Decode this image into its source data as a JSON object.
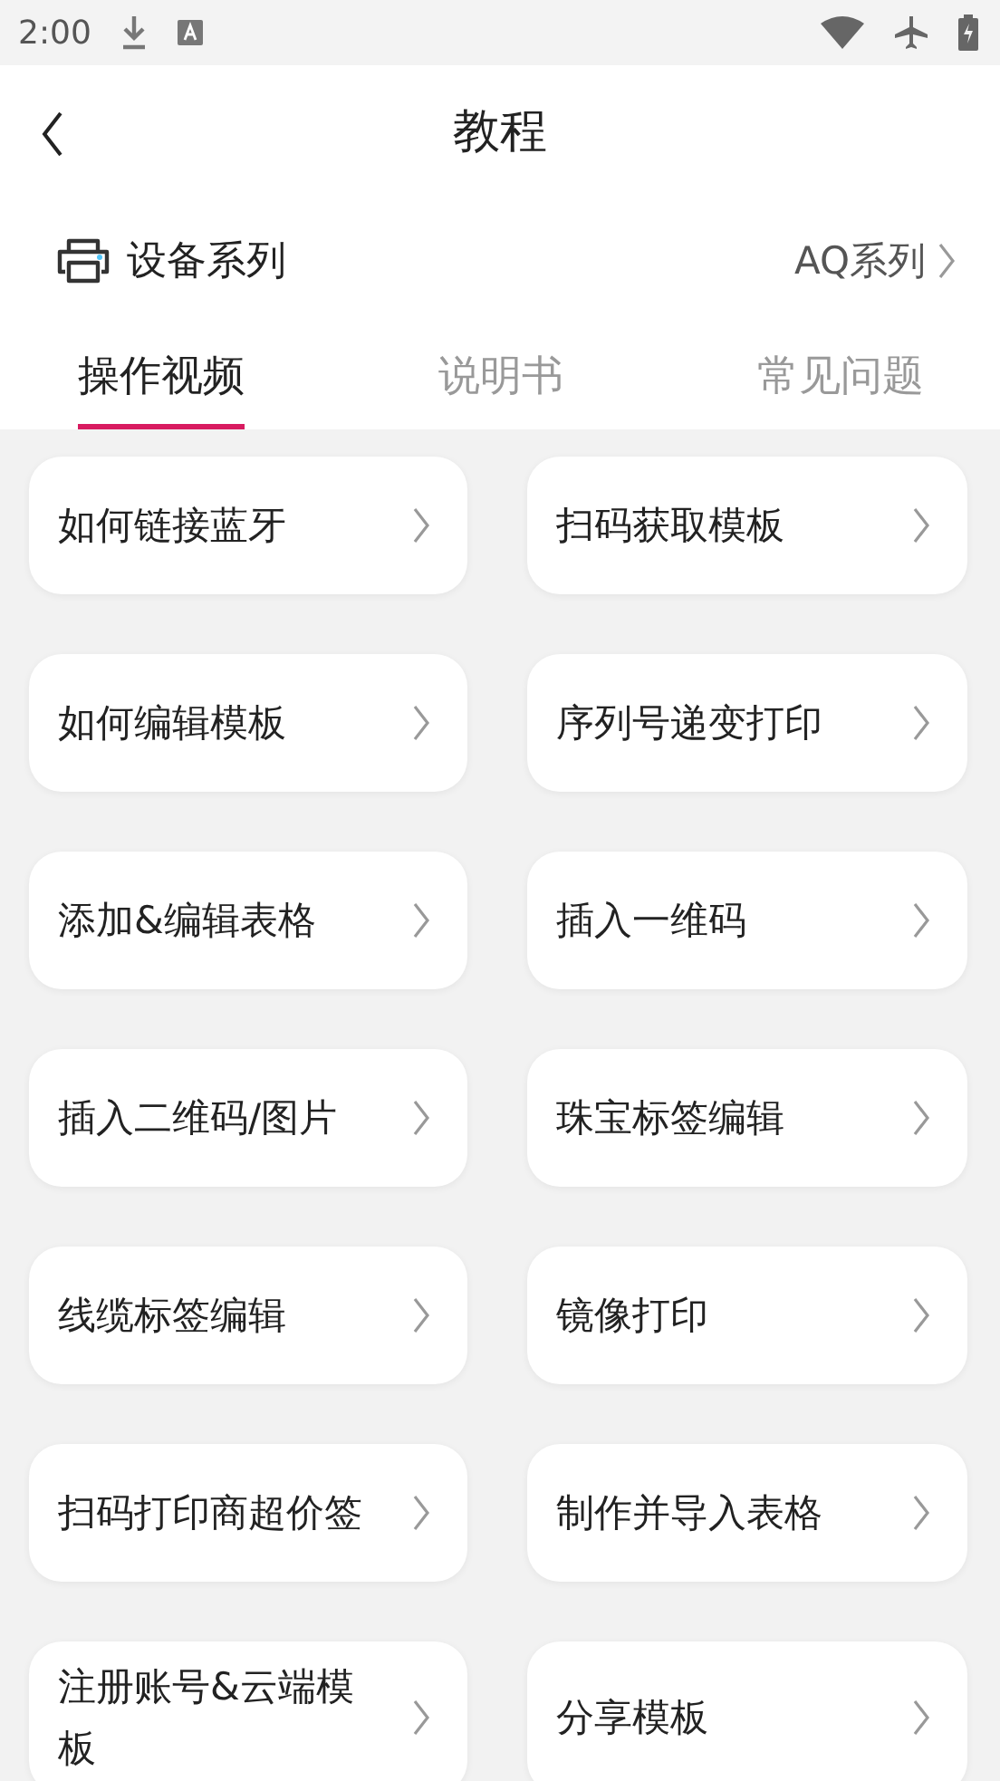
{
  "status_bar": {
    "time": "2:00"
  },
  "header": {
    "title": "教程"
  },
  "device": {
    "label": "设备系列",
    "value": "AQ系列"
  },
  "tabs": [
    {
      "label": "操作视频",
      "selected": true
    },
    {
      "label": "说明书",
      "selected": false
    },
    {
      "label": "常见问题",
      "selected": false
    }
  ],
  "items": [
    {
      "label": "如何链接蓝牙"
    },
    {
      "label": "扫码获取模板"
    },
    {
      "label": "如何编辑模板"
    },
    {
      "label": "序列号递变打印"
    },
    {
      "label": "添加&编辑表格"
    },
    {
      "label": "插入一维码"
    },
    {
      "label": "插入二维码/图片"
    },
    {
      "label": "珠宝标签编辑"
    },
    {
      "label": "线缆标签编辑"
    },
    {
      "label": "镜像打印"
    },
    {
      "label": "扫码打印商超价签"
    },
    {
      "label": "制作并导入表格"
    },
    {
      "label": "注册账号&云端模板"
    },
    {
      "label": "分享模板"
    }
  ]
}
